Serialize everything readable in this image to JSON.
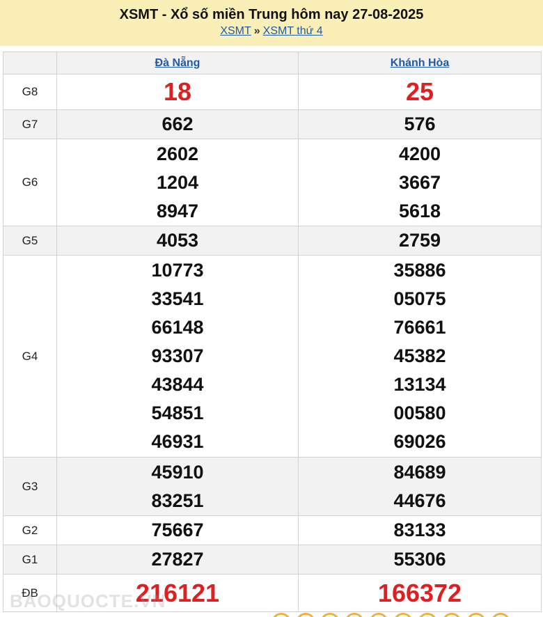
{
  "header": {
    "title": "XSMT - Xổ số miền Trung hôm nay 27-08-2025",
    "crumb_1": "XSMT",
    "separator": "»",
    "crumb_2": "XSMT thứ 4"
  },
  "provinces": [
    "Đà Nẵng",
    "Khánh Hòa"
  ],
  "prizes": {
    "g8": {
      "label": "G8",
      "col1": [
        "18"
      ],
      "col2": [
        "25"
      ]
    },
    "g7": {
      "label": "G7",
      "col1": [
        "662"
      ],
      "col2": [
        "576"
      ]
    },
    "g6": {
      "label": "G6",
      "col1": [
        "2602",
        "1204",
        "8947"
      ],
      "col2": [
        "4200",
        "3667",
        "5618"
      ]
    },
    "g5": {
      "label": "G5",
      "col1": [
        "4053"
      ],
      "col2": [
        "2759"
      ]
    },
    "g4": {
      "label": "G4",
      "col1": [
        "10773",
        "33541",
        "66148",
        "93307",
        "43844",
        "54851",
        "46931"
      ],
      "col2": [
        "35886",
        "05075",
        "76661",
        "45382",
        "13134",
        "00580",
        "69026"
      ]
    },
    "g3": {
      "label": "G3",
      "col1": [
        "45910",
        "83251"
      ],
      "col2": [
        "84689",
        "44676"
      ]
    },
    "g2": {
      "label": "G2",
      "col1": [
        "75667"
      ],
      "col2": [
        "83133"
      ]
    },
    "g1": {
      "label": "G1",
      "col1": [
        "27827"
      ],
      "col2": [
        "55306"
      ]
    },
    "db": {
      "label": "ĐB",
      "col1": [
        "216121"
      ],
      "col2": [
        "166372"
      ]
    }
  },
  "watermark": "BAOQUOCTE.VN",
  "colors": {
    "header_bg": "#fbefb8",
    "link": "#1f5aa6",
    "special_red": "#e02020",
    "row_shade": "#f2f2f2"
  }
}
